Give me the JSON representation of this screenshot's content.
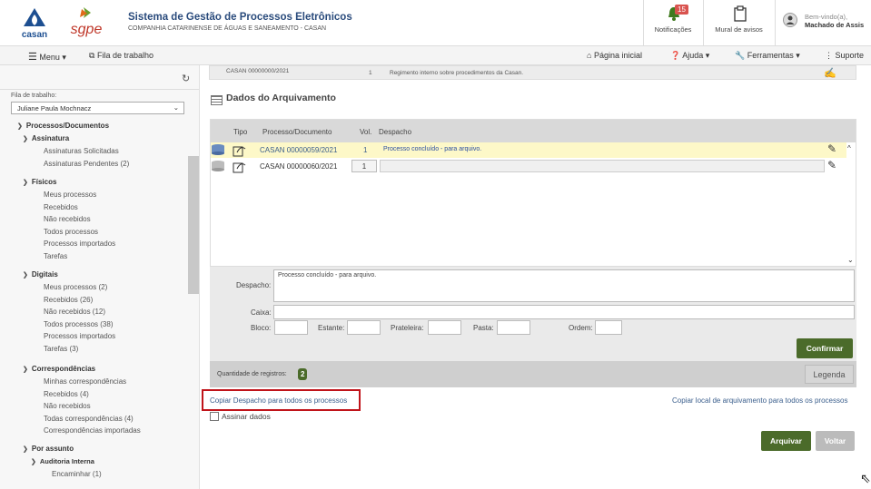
{
  "header": {
    "title": "Sistema de Gestão de Processos Eletrônicos",
    "subtitle": "COMPANHIA CATARINENSE DE ÁGUAS E SANEAMENTO - CASAN",
    "logo_casan": "casan",
    "logo_sgpe": "sgpe",
    "notifications_label": "Notificações",
    "notifications_count": "15",
    "mural_label": "Mural de avisos",
    "welcome": "Bem-vindo(a),",
    "user_name": "Machado de Assis"
  },
  "nav": {
    "menu": "Menu",
    "fila": "Fila de trabalho",
    "pagina_inicial": "Página inicial",
    "ajuda": "Ajuda",
    "ferramentas": "Ferramentas",
    "suporte": "Suporte"
  },
  "sidebar": {
    "fila_label": "Fila de trabalho:",
    "fila_value": "Juliane Paula Mochnacz",
    "processos": "Processos/Documentos",
    "assinatura": "Assinatura",
    "assinaturas_solicitadas": "Assinaturas Solicitadas",
    "assinaturas_pendentes": "Assinaturas Pendentes (2)",
    "fisicos": "Físicos",
    "f_meus": "Meus processos",
    "f_recebidos": "Recebidos",
    "f_nao_recebidos": "Não recebidos",
    "f_todos": "Todos processos",
    "f_importados": "Processos importados",
    "f_tarefas": "Tarefas",
    "digitais": "Digitais",
    "d_meus": "Meus processos (2)",
    "d_recebidos": "Recebidos (26)",
    "d_nao_recebidos": "Não recebidos (12)",
    "d_todos": "Todos processos (38)",
    "d_importados": "Processos importados",
    "d_tarefas": "Tarefas (3)",
    "correspondencias": "Correspondências",
    "c_minhas": "Minhas correspondências",
    "c_recebidos": "Recebidos (4)",
    "c_nao_recebidos": "Não recebidos",
    "c_todas": "Todas correspondências (4)",
    "c_importadas": "Correspondências importadas",
    "por_assunto": "Por assunto",
    "auditoria": "Auditoria Interna",
    "encaminhar": "Encaminhar (1)"
  },
  "main": {
    "top_row_process": "CASAN 00000000/2021",
    "top_row_vol": "1",
    "top_row_despacho": "Regimento interno sobre procedimentos da Casan.",
    "section_title": "Dados do Arquivamento",
    "columns": [
      "Tipo",
      "Processo/Documento",
      "Vol.",
      "Despacho"
    ],
    "rows": [
      {
        "processo": "CASAN 00000059/2021",
        "vol": "1",
        "despacho": "Processo concluído - para arquivo."
      },
      {
        "processo": "CASAN 00000060/2021",
        "vol": "1",
        "despacho": ""
      }
    ],
    "form": {
      "despacho_label": "Despacho:",
      "despacho_value": "Processo concluído - para arquivo.",
      "caixa_label": "Caixa:",
      "bloco_label": "Bloco:",
      "estante_label": "Estante:",
      "prateleira_label": "Prateleira:",
      "pasta_label": "Pasta:",
      "ordem_label": "Ordem:",
      "confirmar": "Confirmar"
    },
    "quantidade_label": "Quantidade de registros:",
    "quantidade_value": "2",
    "legenda": "Legenda",
    "copiar_despacho": "Copiar Despacho para todos os processos",
    "copiar_local": "Copiar local de arquivamento para todos os processos",
    "assinar_dados": "Assinar dados",
    "arquivar": "Arquivar",
    "voltar": "Voltar"
  },
  "colors": {
    "accent_green": "#4b6b2a",
    "title_blue": "#2a4b7c",
    "highlight_red": "#c0141a",
    "row_highlight": "#fdf8c8"
  }
}
